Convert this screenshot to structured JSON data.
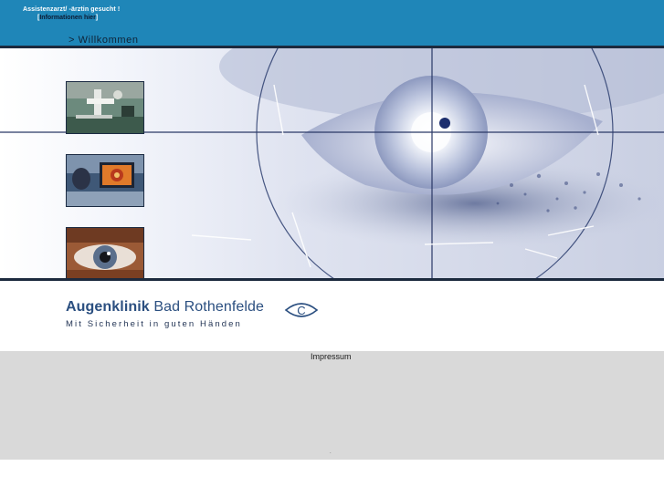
{
  "header": {
    "job_notice": "Assistenzarzt/ -ärztin gesucht !",
    "job_link_prefix": "[",
    "job_link": "Informationen hier",
    "job_link_suffix": "]",
    "welcome_link": "> Willkommen"
  },
  "hero": {
    "thumbnails": [
      "microscope",
      "eye-scan-monitor",
      "eye-closeup"
    ]
  },
  "logo": {
    "name_bold": "Augenklinik",
    "name_rest": " Bad Rothenfelde",
    "slogan": "Mit Sicherheit in guten Händen",
    "emblem_letter": "C"
  },
  "footer": {
    "impressum": "Impressum",
    "dot": "."
  },
  "colors": {
    "header_bg": "#1f86b8",
    "brand_blue": "#2b4f80",
    "footer_gray": "#d9d9d9"
  }
}
